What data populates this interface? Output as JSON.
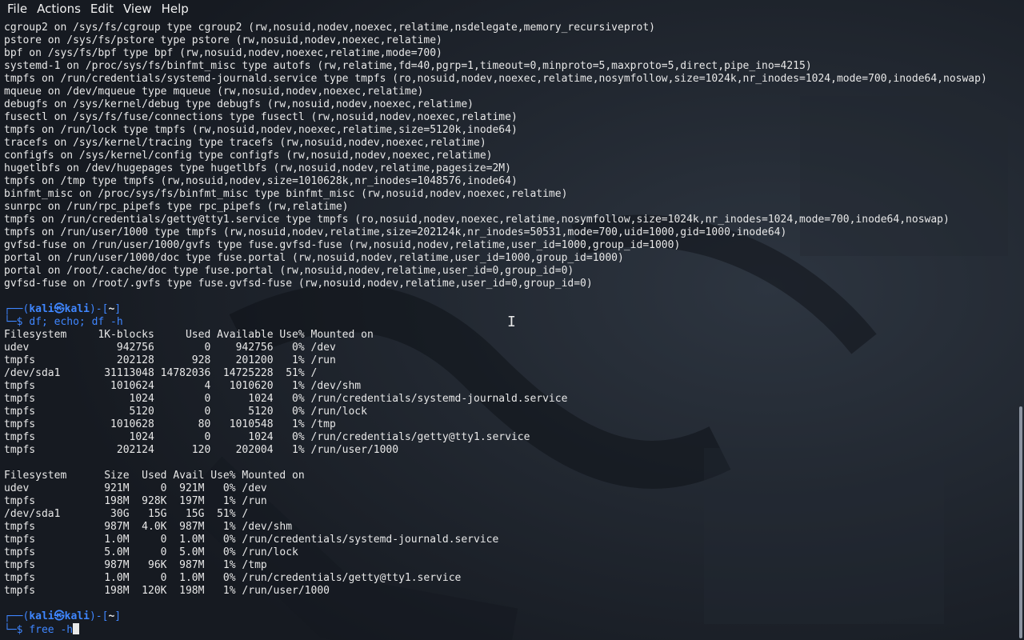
{
  "menubar": {
    "items": [
      "File",
      "Actions",
      "Edit",
      "View",
      "Help"
    ]
  },
  "prompt": {
    "open_corner": "┌──(",
    "user": "kali",
    "at": "㉿",
    "host": "kali",
    "close": ")-[",
    "path": "~",
    "end": "]",
    "line2": "└─$ "
  },
  "terminal": {
    "mount_lines": [
      "cgroup2 on /sys/fs/cgroup type cgroup2 (rw,nosuid,nodev,noexec,relatime,nsdelegate,memory_recursiveprot)",
      "pstore on /sys/fs/pstore type pstore (rw,nosuid,nodev,noexec,relatime)",
      "bpf on /sys/fs/bpf type bpf (rw,nosuid,nodev,noexec,relatime,mode=700)",
      "systemd-1 on /proc/sys/fs/binfmt_misc type autofs (rw,relatime,fd=40,pgrp=1,timeout=0,minproto=5,maxproto=5,direct,pipe_ino=4215)",
      "tmpfs on /run/credentials/systemd-journald.service type tmpfs (ro,nosuid,nodev,noexec,relatime,nosymfollow,size=1024k,nr_inodes=1024,mode=700,inode64,noswap)",
      "mqueue on /dev/mqueue type mqueue (rw,nosuid,nodev,noexec,relatime)",
      "debugfs on /sys/kernel/debug type debugfs (rw,nosuid,nodev,noexec,relatime)",
      "fusectl on /sys/fs/fuse/connections type fusectl (rw,nosuid,nodev,noexec,relatime)",
      "tmpfs on /run/lock type tmpfs (rw,nosuid,nodev,noexec,relatime,size=5120k,inode64)",
      "tracefs on /sys/kernel/tracing type tracefs (rw,nosuid,nodev,noexec,relatime)",
      "configfs on /sys/kernel/config type configfs (rw,nosuid,nodev,noexec,relatime)",
      "hugetlbfs on /dev/hugepages type hugetlbfs (rw,nosuid,nodev,relatime,pagesize=2M)",
      "tmpfs on /tmp type tmpfs (rw,nosuid,nodev,size=1010628k,nr_inodes=1048576,inode64)",
      "binfmt_misc on /proc/sys/fs/binfmt_misc type binfmt_misc (rw,nosuid,nodev,noexec,relatime)",
      "sunrpc on /run/rpc_pipefs type rpc_pipefs (rw,relatime)",
      "tmpfs on /run/credentials/getty@tty1.service type tmpfs (ro,nosuid,nodev,noexec,relatime,nosymfollow,size=1024k,nr_inodes=1024,mode=700,inode64,noswap)",
      "tmpfs on /run/user/1000 type tmpfs (rw,nosuid,nodev,relatime,size=202124k,nr_inodes=50531,mode=700,uid=1000,gid=1000,inode64)",
      "gvfsd-fuse on /run/user/1000/gvfs type fuse.gvfsd-fuse (rw,nosuid,nodev,relatime,user_id=1000,group_id=1000)",
      "portal on /run/user/1000/doc type fuse.portal (rw,nosuid,nodev,relatime,user_id=1000,group_id=1000)",
      "portal on /root/.cache/doc type fuse.portal (rw,nosuid,nodev,relatime,user_id=0,group_id=0)",
      "gvfsd-fuse on /root/.gvfs type fuse.gvfsd-fuse (rw,nosuid,nodev,relatime,user_id=0,group_id=0)"
    ],
    "command1": "df; echo; df -h",
    "df_lines": [
      "Filesystem     1K-blocks     Used Available Use% Mounted on",
      "udev              942756        0    942756   0% /dev",
      "tmpfs             202128      928    201200   1% /run",
      "/dev/sda1       31113048 14782036  14725228  51% /",
      "tmpfs            1010624        4   1010620   1% /dev/shm",
      "tmpfs               1024        0      1024   0% /run/credentials/systemd-journald.service",
      "tmpfs               5120        0      5120   0% /run/lock",
      "tmpfs            1010628       80   1010548   1% /tmp",
      "tmpfs               1024        0      1024   0% /run/credentials/getty@tty1.service",
      "tmpfs             202124      120    202004   1% /run/user/1000"
    ],
    "dfh_lines": [
      "Filesystem      Size  Used Avail Use% Mounted on",
      "udev            921M     0  921M   0% /dev",
      "tmpfs           198M  928K  197M   1% /run",
      "/dev/sda1        30G   15G   15G  51% /",
      "tmpfs           987M  4.0K  987M   1% /dev/shm",
      "tmpfs           1.0M     0  1.0M   0% /run/credentials/systemd-journald.service",
      "tmpfs           5.0M     0  5.0M   0% /run/lock",
      "tmpfs           987M   96K  987M   1% /tmp",
      "tmpfs           1.0M     0  1.0M   0% /run/credentials/getty@tty1.service",
      "tmpfs           198M  120K  198M   1% /run/user/1000"
    ],
    "command2": "free -h"
  },
  "colors": {
    "background": "#1c2129",
    "text": "#e8e8e8",
    "prompt": "#3f86ff"
  }
}
